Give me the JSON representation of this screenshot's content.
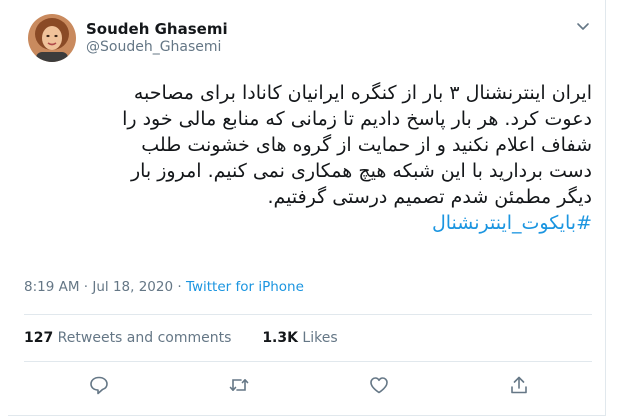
{
  "user": {
    "name": "Soudeh Ghasemi",
    "handle": "@Soudeh_Ghasemi"
  },
  "tweet": {
    "lines": [
      "ایران اینترنشنال ۳ بار از کنگره ایرانیان کانادا برای مصاحبه",
      "دعوت کرد. هر بار پاسخ دادیم تا زمانی که منابع مالی خود را",
      "شفاف اعلام نکنید و از حمایت از گروه های خشونت طلب",
      "دست بردارید با این شبکه هیچ همکاری نمی کنیم. امروز بار",
      "دیگر مطمئن شدم تصمیم درستی گرفتیم."
    ],
    "hashtag": "#بایکوت_اینترنشنال"
  },
  "meta": {
    "timestamp": "8:19 AM · Jul 18, 2020 · ",
    "source": "Twitter for iPhone"
  },
  "stats": {
    "retweets_count": "127",
    "retweets_label": " Retweets and comments",
    "likes_count": "1.3K",
    "likes_label": " Likes"
  },
  "actions": [
    "reply-icon",
    "retweet-icon",
    "like-icon",
    "share-icon"
  ],
  "colors": {
    "link": "#1b95e0",
    "secondary": "#657786",
    "divider": "#e1e8ed"
  }
}
